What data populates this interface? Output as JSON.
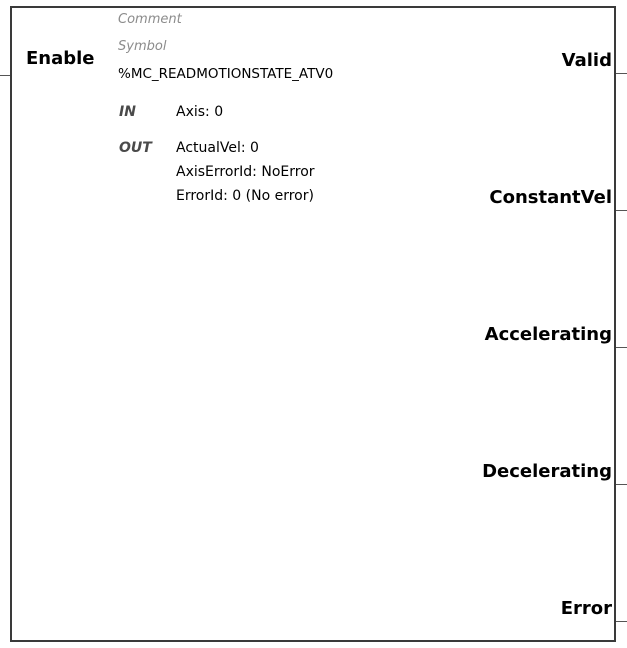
{
  "block": {
    "instance_name": "%MC_READMOTIONSTATE_ATV0",
    "comment_label": "Comment",
    "symbol_label": "Symbol",
    "inputs": [
      {
        "name": "Enable"
      }
    ],
    "outputs": [
      {
        "name": "Valid"
      },
      {
        "name": "ConstantVel"
      },
      {
        "name": "Accelerating"
      },
      {
        "name": "Decelerating"
      },
      {
        "name": "Error"
      }
    ],
    "in_keyword": "IN",
    "out_keyword": "OUT",
    "in_params": [
      "Axis: 0"
    ],
    "out_params": [
      "ActualVel: 0",
      "AxisErrorId: NoError",
      "ErrorId: 0 (No error)"
    ]
  }
}
